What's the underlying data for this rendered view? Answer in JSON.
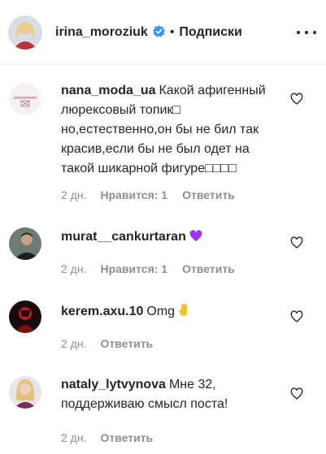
{
  "header": {
    "username": "irina_moroziuk",
    "separator": "•",
    "follow_label": "Подписки"
  },
  "comments": [
    {
      "username": "nana_moda_ua",
      "text": "Какой афигенный люрексовый топик□ но,естественно,он бы не бил так красив,если бы не был одет на такой шикарной фигуре□□□□",
      "time": "2 дн.",
      "likes": "Нравится: 1",
      "reply": "Ответить"
    },
    {
      "username": "murat__cankurtaran",
      "text": "",
      "emoji": "purple-heart",
      "time": "2 дн.",
      "likes": "Нравится: 1",
      "reply": "Ответить"
    },
    {
      "username": "kerem.axu.10",
      "text": "Omg",
      "emoji": "waving-hand",
      "time": "2 дн.",
      "likes": "",
      "reply": "Ответить"
    },
    {
      "username": "nataly_lytvynova",
      "text": "Мне 32, поддерживаю смысл поста!",
      "time": "2 дн.",
      "likes": "",
      "reply": "Ответить"
    }
  ],
  "colors": {
    "text": "#262626",
    "muted": "#8e8e8e",
    "verified": "#3897f0",
    "purple_heart": "#a033ff",
    "hand": "#f4c12c"
  }
}
